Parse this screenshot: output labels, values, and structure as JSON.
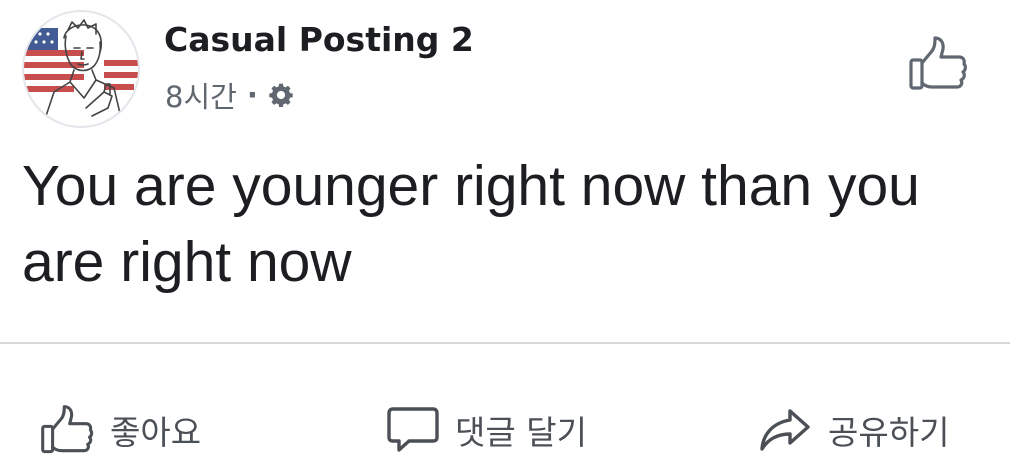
{
  "post": {
    "author": "Casual Posting 2",
    "time": "8시간",
    "separator": "·",
    "privacy_icon": "gear-icon",
    "text": "You are younger right now than you are right now"
  },
  "header_actions": {
    "like_icon": "thumbs-up-icon"
  },
  "actions": {
    "like_label": "좋아요",
    "comment_label": "댓글 달기",
    "share_label": "공유하기"
  },
  "colors": {
    "text": "#1c1e21",
    "secondary": "#606770",
    "action": "#4b4f56",
    "divider": "#d6d8dc"
  }
}
